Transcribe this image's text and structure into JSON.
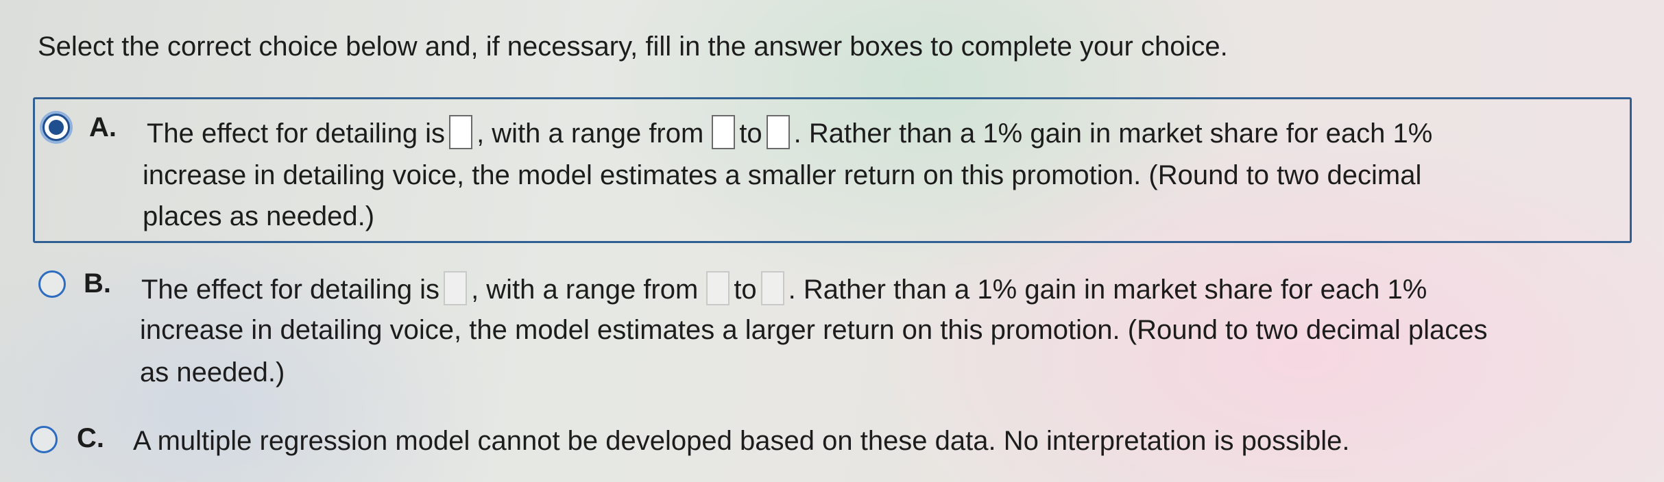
{
  "instruction": "Select the correct choice below and, if necessary, fill in the answer boxes to complete your choice.",
  "choices": [
    {
      "letter": "A.",
      "selected": true,
      "line1": {
        "seg1": "The effect for detailing is",
        "seg2": ", with a range from",
        "seg3": "to",
        "seg4": ". Rather than a 1% gain in market share for each 1%"
      },
      "line2": "increase in detailing voice, the model estimates a smaller return on this promotion. (Round to two decimal",
      "line3": "places as needed.)"
    },
    {
      "letter": "B.",
      "selected": false,
      "line1": {
        "seg1": "The effect for detailing is",
        "seg2": ", with a range from",
        "seg3": "to",
        "seg4": ". Rather than a 1% gain in market share for each 1%"
      },
      "line2": "increase in detailing voice, the model estimates a larger return on this promotion. (Round to two decimal places",
      "line3": "as needed.)"
    },
    {
      "letter": "C.",
      "selected": false,
      "line1": "A multiple regression model cannot be developed based on these data. No interpretation is possible."
    }
  ],
  "colors": {
    "selection_border": "#2f5f93",
    "radio": "#2d6cc0"
  }
}
